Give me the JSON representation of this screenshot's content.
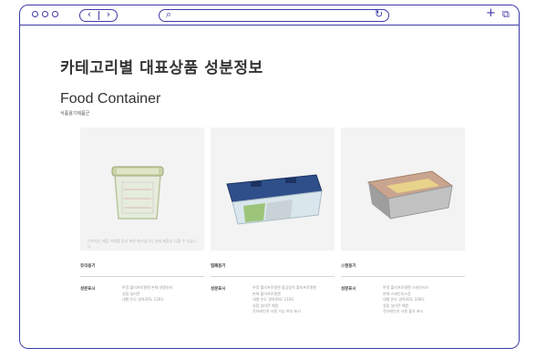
{
  "browser": {
    "nav_back": "‹",
    "nav_forward": "›",
    "search_symbol": "⌕",
    "reload_symbol": "↻",
    "new_tab_symbol": "+",
    "copy_symbol": "⧉",
    "accent": "#3d3aa8"
  },
  "page": {
    "title": "카테고리별 대표상품 성분정보",
    "section_title": "Food Container",
    "section_subtitle": "식품용기제품군"
  },
  "products": [
    {
      "name": "유리용기",
      "caption": "이미지는 제품 이해를 돕기 위한 예시입니다 실제 제품과 다를 수 있습니다",
      "label": "성분표시",
      "details": [
        "뚜껑 폴리프로필렌 본체 내열유리",
        "실링 실리콘",
        "내열 온도 영하20도 120도"
      ]
    },
    {
      "name": "밀폐용기",
      "caption": "",
      "label": "성분표시",
      "details": [
        "뚜껑 폴리프로필렌 잠금장치 폴리프로필렌",
        "본체 폴리프로필렌",
        "내열 온도 영하20도 110도",
        "실링 실리콘 패킹",
        "전자레인지 사용 가능 여부 표시"
      ]
    },
    {
      "name": "스텐용기",
      "caption": "",
      "label": "성분표시",
      "details": [
        "뚜껑 폴리프로필렌 스테인리스",
        "본체 스테인리스강",
        "내열 온도 영하20도 100도",
        "실링 실리콘 패킹",
        "전자레인지 사용 불가 표시"
      ]
    }
  ]
}
